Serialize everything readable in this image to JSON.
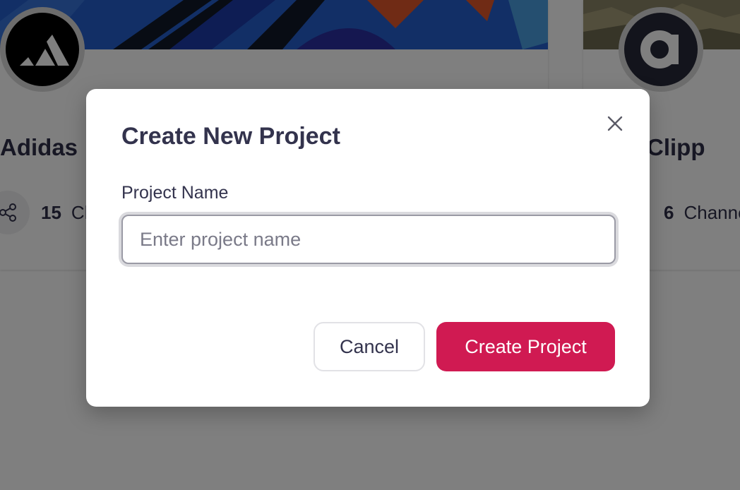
{
  "background": {
    "cards": [
      {
        "title": "Adidas",
        "stat_count": "15",
        "stat_label": "Channels"
      },
      {
        "title": "Clipp",
        "stat_count": "6",
        "stat_label": "Channels"
      }
    ]
  },
  "modal": {
    "title": "Create New Project",
    "close_icon": "close-icon",
    "field": {
      "label": "Project Name",
      "value": "",
      "placeholder": "Enter project name"
    },
    "buttons": {
      "cancel_label": "Cancel",
      "create_label": "Create Project"
    }
  },
  "colors": {
    "primary": "#d01a52",
    "text": "#33334d",
    "overlay": "rgba(0,0,0,0.5)"
  }
}
